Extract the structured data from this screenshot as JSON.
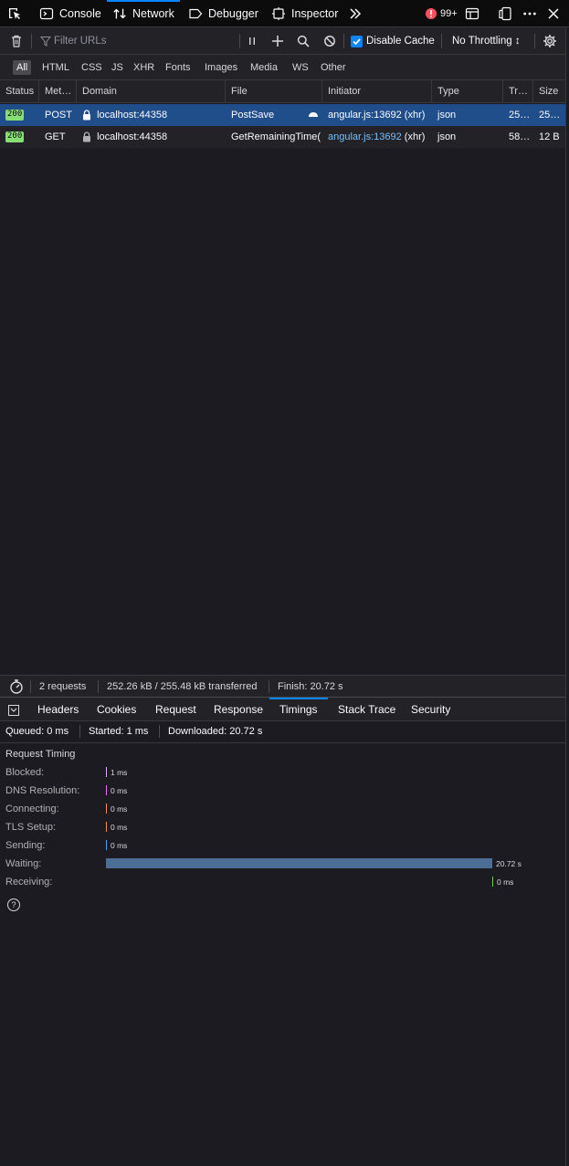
{
  "toolbar": {
    "tabs": [
      {
        "label": "Console",
        "icon": "console-icon"
      },
      {
        "label": "Network",
        "icon": "network-arrows-icon"
      },
      {
        "label": "Debugger",
        "icon": "debugger-icon"
      },
      {
        "label": "Inspector",
        "icon": "inspector-icon"
      }
    ],
    "error_count": "99+"
  },
  "filter": {
    "placeholder": "Filter URLs",
    "disable_cache_label": "Disable Cache",
    "disable_cache_checked": true,
    "throttling": "No Throttling ↕"
  },
  "type_filters": [
    "All",
    "HTML",
    "CSS",
    "JS",
    "XHR",
    "Fonts",
    "Images",
    "Media",
    "WS",
    "Other"
  ],
  "columns": [
    "Status",
    "Met…",
    "Domain",
    "File",
    "Initiator",
    "Type",
    "Tr…",
    "Size"
  ],
  "requests": [
    {
      "status": "200",
      "method": "POST",
      "domain": "localhost:44358",
      "file": "PostSave",
      "initiator_link": "angular.js:13692",
      "initiator_suffix": "(xhr)",
      "type": "json",
      "transferred": "25…",
      "size": "25…"
    },
    {
      "status": "200",
      "method": "GET",
      "domain": "localhost:44358",
      "file": "GetRemainingTime(",
      "initiator_link": "angular.js:13692",
      "initiator_suffix": "(xhr)",
      "type": "json",
      "transferred": "58…",
      "size": "12 B"
    }
  ],
  "summary": {
    "requests": "2 requests",
    "transferred": "252.26 kB / 255.48 kB transferred",
    "finish": "Finish: 20.72 s"
  },
  "detail_tabs": [
    "Headers",
    "Cookies",
    "Request",
    "Response",
    "Timings",
    "Stack Trace",
    "Security"
  ],
  "timings_summary": {
    "queued": "Queued: 0 ms",
    "started": "Started: 1 ms",
    "downloaded": "Downloaded: 20.72 s"
  },
  "request_timing": {
    "title": "Request Timing",
    "phases": [
      {
        "label": "Blocked:",
        "value": "1 ms",
        "color": "#e4a6ff"
      },
      {
        "label": "DNS Resolution:",
        "value": "0 ms",
        "color": "#e56aff"
      },
      {
        "label": "Connecting:",
        "value": "0 ms",
        "color": "#ff8b3d"
      },
      {
        "label": "TLS Setup:",
        "value": "0 ms",
        "color": "#ff8b3d"
      },
      {
        "label": "Sending:",
        "value": "0 ms",
        "color": "#45a1ff"
      },
      {
        "label": "Waiting:",
        "value": "20.72 s",
        "color": "#4c6e94"
      },
      {
        "label": "Receiving:",
        "value": "0 ms",
        "color": "#70cf5b"
      }
    ]
  },
  "colors": {
    "accent": "#0a84ff",
    "selected_row": "#204e8a",
    "status_ok": "#86de74",
    "error_badge": "#ff4f5e"
  }
}
